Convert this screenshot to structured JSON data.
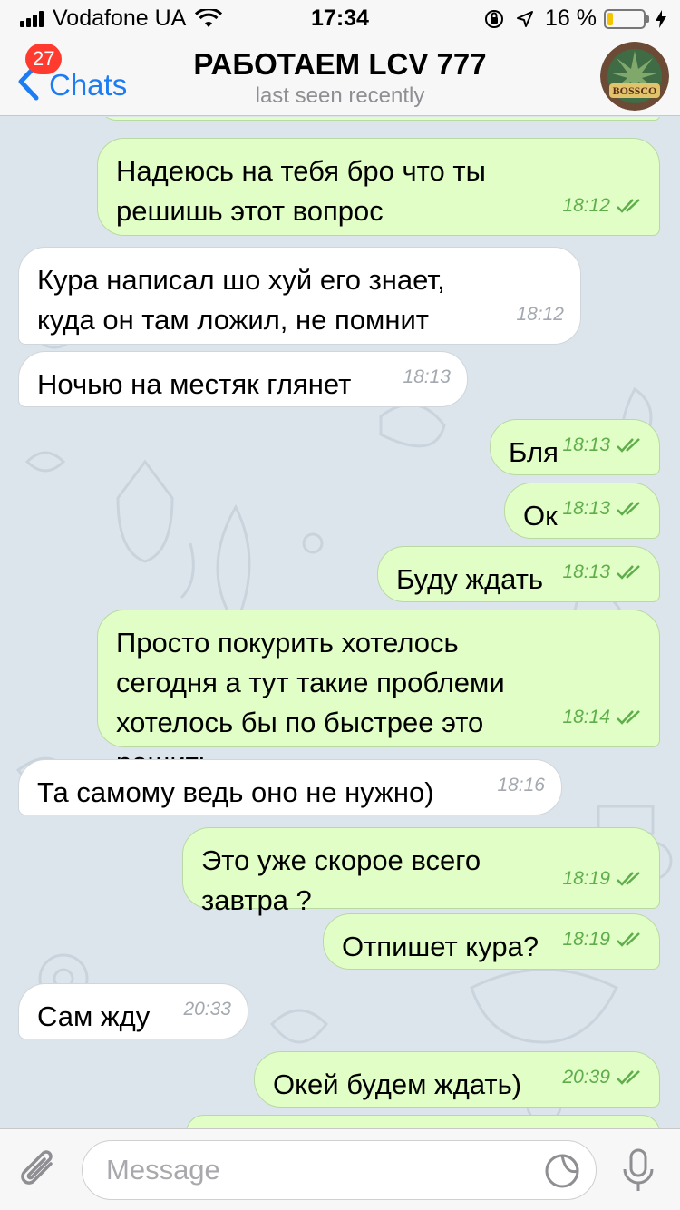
{
  "status_bar": {
    "carrier": "Vodafone UA",
    "time": "17:34",
    "battery_text": "16 %",
    "battery_level": 0.16
  },
  "header": {
    "back_label": "Chats",
    "unread_count": "27",
    "title": "РАБОТАЕМ LCV 777",
    "subtitle": "last seen recently",
    "avatar_text": "BOSSCO"
  },
  "messages": [
    {
      "dir": "out",
      "text": "Надеюсь на тебя бро что ты решишь этот вопрос",
      "time": "18:12",
      "read": true
    },
    {
      "dir": "in",
      "text": "Кура написал шо хуй его знает, куда он там ложил, не помнит",
      "time": "18:12"
    },
    {
      "dir": "in",
      "text": "Ночью на местяк глянет",
      "time": "18:13"
    },
    {
      "dir": "out",
      "text": "Бля",
      "time": "18:13",
      "read": true
    },
    {
      "dir": "out",
      "text": "Ок",
      "time": "18:13",
      "read": true
    },
    {
      "dir": "out",
      "text": "Буду ждать",
      "time": "18:13",
      "read": true
    },
    {
      "dir": "out",
      "text": "Просто покурить хотелось сегодня а тут такие проблеми хотелось бы по быстрее это решить",
      "time": "18:14",
      "read": true
    },
    {
      "dir": "in",
      "text": "Та самому ведь оно не нужно)",
      "time": "18:16"
    },
    {
      "dir": "out",
      "text": "Это уже скорое всего завтра ?",
      "time": "18:19",
      "read": true
    },
    {
      "dir": "out",
      "text": "Отпишет кура?",
      "time": "18:19",
      "read": true
    },
    {
      "dir": "in",
      "text": "Сам жду",
      "time": "20:33"
    },
    {
      "dir": "out",
      "text": "Окей будем ждать)",
      "time": "20:39",
      "read": true
    }
  ],
  "input": {
    "placeholder": "Message"
  },
  "colors": {
    "accent": "#1c7cf4",
    "outgoing_bubble": "#e1fec6",
    "incoming_bubble": "#ffffff",
    "read_check": "#5fad4b",
    "badge": "#ff3b30",
    "wallpaper": "#dde5ec"
  },
  "icons": {
    "back": "chevron-left-icon",
    "attach": "paperclip-icon",
    "sticker": "sticker-icon",
    "mic": "microphone-icon",
    "read": "double-check-icon"
  }
}
